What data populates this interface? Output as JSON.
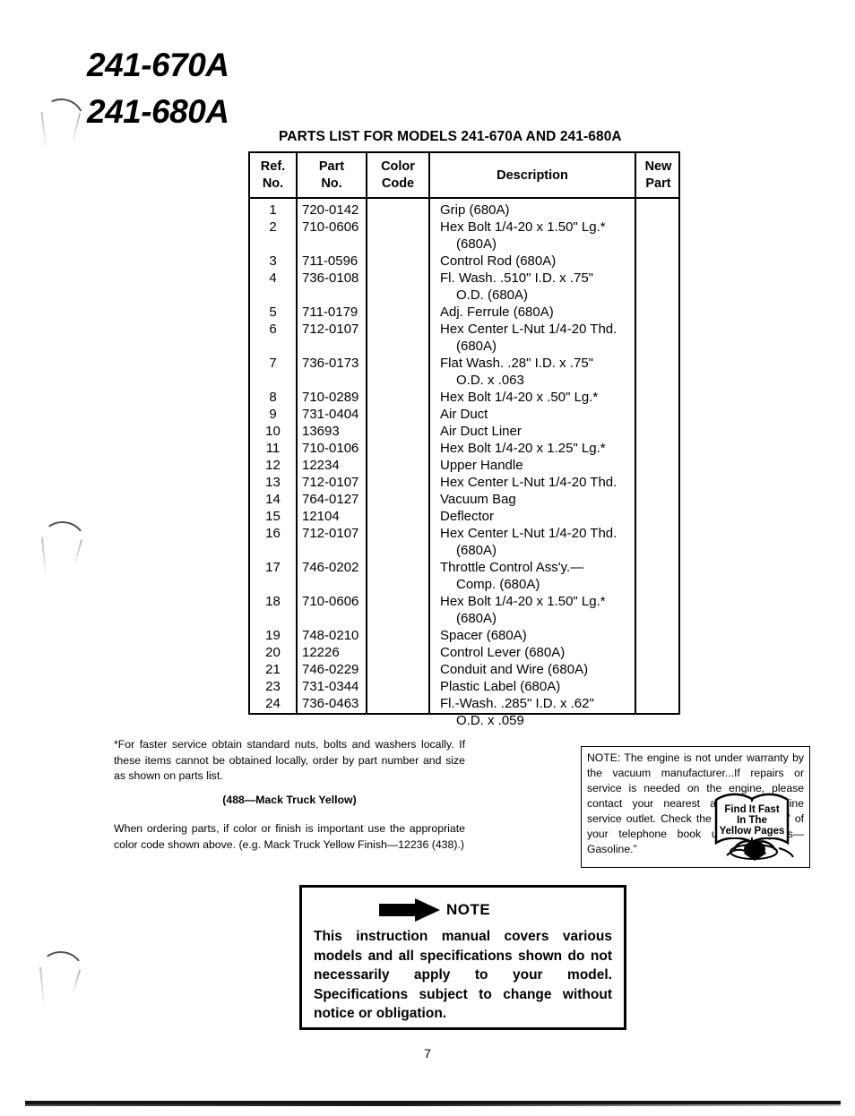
{
  "models": {
    "line1": "241-670A",
    "line2": "241-680A"
  },
  "caption": "PARTS LIST FOR MODELS 241-670A AND 241-680A",
  "table": {
    "headers": {
      "ref": "Ref.\nNo.",
      "ref_line1": "Ref.",
      "ref_line2": "No.",
      "part_line1": "Part",
      "part_line2": "No.",
      "color_line1": "Color",
      "color_line2": "Code",
      "description": "Description",
      "new_line1": "New",
      "new_line2": "Part"
    },
    "rows": [
      {
        "ref": "1",
        "part": "720-0142",
        "color": "",
        "desc": "Grip (680A)",
        "cont": ""
      },
      {
        "ref": "2",
        "part": "710-0606",
        "color": "",
        "desc": "Hex Bolt 1/4-20 x 1.50\" Lg.*",
        "cont": "(680A)"
      },
      {
        "ref": "3",
        "part": "711-0596",
        "color": "",
        "desc": "Control Rod (680A)",
        "cont": ""
      },
      {
        "ref": "4",
        "part": "736-0108",
        "color": "",
        "desc": "Fl. Wash. .510\" I.D. x .75\"",
        "cont": "O.D. (680A)"
      },
      {
        "ref": "5",
        "part": "711-0179",
        "color": "",
        "desc": "Adj. Ferrule (680A)",
        "cont": ""
      },
      {
        "ref": "6",
        "part": "712-0107",
        "color": "",
        "desc": "Hex Center L-Nut 1/4-20 Thd.",
        "cont": "(680A)"
      },
      {
        "ref": "7",
        "part": "736-0173",
        "color": "",
        "desc": "Flat Wash. .28\" I.D. x .75\"",
        "cont": "O.D. x .063"
      },
      {
        "ref": "8",
        "part": "710-0289",
        "color": "",
        "desc": "Hex Bolt 1/4-20 x .50\" Lg.*",
        "cont": ""
      },
      {
        "ref": "9",
        "part": "731-0404",
        "color": "",
        "desc": "Air Duct",
        "cont": ""
      },
      {
        "ref": "10",
        "part": "13693",
        "color": "",
        "desc": "Air Duct Liner",
        "cont": ""
      },
      {
        "ref": "11",
        "part": "710-0106",
        "color": "",
        "desc": "Hex Bolt 1/4-20 x 1.25\" Lg.*",
        "cont": ""
      },
      {
        "ref": "12",
        "part": "12234",
        "color": "",
        "desc": "Upper Handle",
        "cont": ""
      },
      {
        "ref": "13",
        "part": "712-0107",
        "color": "",
        "desc": "Hex Center L-Nut 1/4-20 Thd.",
        "cont": ""
      },
      {
        "ref": "14",
        "part": "764-0127",
        "color": "",
        "desc": "Vacuum Bag",
        "cont": ""
      },
      {
        "ref": "15",
        "part": "12104",
        "color": "",
        "desc": "Deflector",
        "cont": ""
      },
      {
        "ref": "16",
        "part": "712-0107",
        "color": "",
        "desc": "Hex Center L-Nut 1/4-20 Thd.",
        "cont": "(680A)"
      },
      {
        "ref": "17",
        "part": "746-0202",
        "color": "",
        "desc": "Throttle Control Ass'y.—",
        "cont": "Comp. (680A)"
      },
      {
        "ref": "18",
        "part": "710-0606",
        "color": "",
        "desc": "Hex Bolt 1/4-20 x 1.50\" Lg.*",
        "cont": "(680A)"
      },
      {
        "ref": "19",
        "part": "748-0210",
        "color": "",
        "desc": "Spacer (680A)",
        "cont": ""
      },
      {
        "ref": "20",
        "part": "12226",
        "color": "",
        "desc": "Control Lever (680A)",
        "cont": ""
      },
      {
        "ref": "21",
        "part": "746-0229",
        "color": "",
        "desc": "Conduit and Wire (680A)",
        "cont": ""
      },
      {
        "ref": "23",
        "part": "731-0344",
        "color": "",
        "desc": "Plastic Label (680A)",
        "cont": ""
      },
      {
        "ref": "24",
        "part": "736-0463",
        "color": "",
        "desc": "Fl.-Wash. .285\" I.D. x .62\"",
        "cont": "O.D. x .059"
      }
    ]
  },
  "footnotes": {
    "asterisk": "*For faster service obtain standard nuts, bolts and washers locally. If these items cannot be obtained locally, order by part number and size as shown on parts list.",
    "color_code": "(488—Mack Truck Yellow)",
    "ordering": "When ordering parts, if color or finish is important use the appropriate color code shown above. (e.g. Mack Truck Yellow Finish—12236 (438).)"
  },
  "engine_note": {
    "text": "NOTE: The engine is not under warranty by the vacuum manufacturer...If repairs or service is needed on the engine, please contact your nearest authorized engine service outlet. Check the “Yellow Pages” of your telephone book under “Engines—Gasoline.”",
    "graphic": {
      "line1": "Find It Fast",
      "line2": "In The",
      "line3": "Yellow Pages"
    }
  },
  "note_box": {
    "label": "NOTE",
    "body": "This instruction manual covers various models and all specifications shown do not necessarily apply to your model. Specifications subject to change without notice or obligation."
  },
  "page_number": "7"
}
